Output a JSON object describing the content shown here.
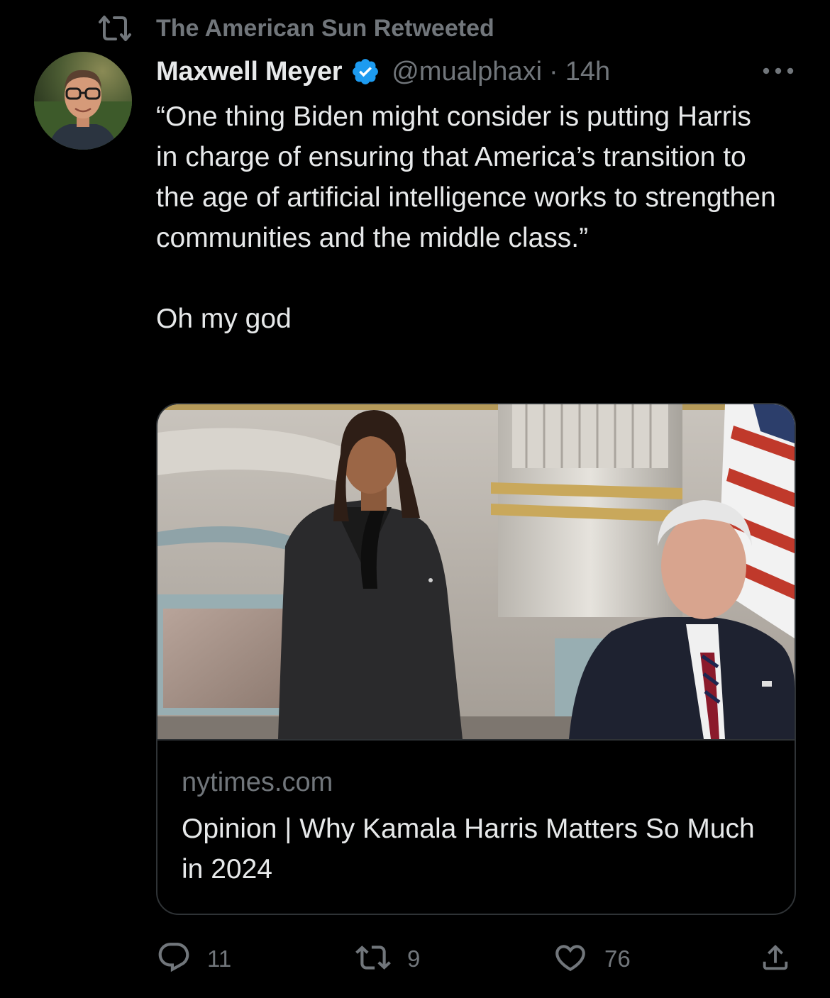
{
  "retweet_header": {
    "label": "The American Sun Retweeted",
    "icon": "retweet-icon"
  },
  "author": {
    "name": "Maxwell Meyer",
    "handle": "@mualphaxi",
    "separator": "·",
    "time": "14h",
    "verified": true,
    "verified_color": "#1d9bf0"
  },
  "tweet": {
    "paragraphs": [
      "“One thing Biden might consider is putting Harris in charge of ensuring that America’s transition to the age of artificial intelligence works to strengthen communities and the middle class.”",
      "Oh my god"
    ]
  },
  "card": {
    "domain": "nytimes.com",
    "title": "Opinion | Why Kamala Harris Matters So Much in 2024"
  },
  "actions": {
    "reply_count": "11",
    "retweet_count": "9",
    "like_count": "76"
  },
  "colors": {
    "background": "#000000",
    "text_primary": "#e7e9ea",
    "text_secondary": "#71767b",
    "border": "#2f3336"
  }
}
